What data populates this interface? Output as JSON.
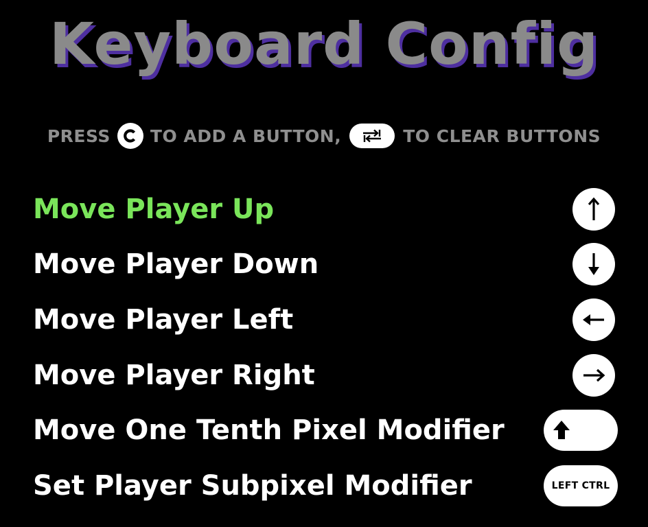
{
  "title": "Keyboard Config",
  "hint": {
    "press": "PRESS",
    "add_key_icon": "c-key-icon",
    "to_add": "TO ADD A BUTTON,",
    "clear_key_icon": "swap-arrows-icon",
    "to_clear": "TO CLEAR BUTTONS"
  },
  "bindings": [
    {
      "label": "Move Player Up",
      "key_icon": "arrow-up-icon",
      "selected": true
    },
    {
      "label": "Move Player Down",
      "key_icon": "arrow-down-icon",
      "selected": false
    },
    {
      "label": "Move Player Left",
      "key_icon": "arrow-left-icon",
      "selected": false
    },
    {
      "label": "Move Player Right",
      "key_icon": "arrow-right-icon",
      "selected": false
    },
    {
      "label": "Move One Tenth Pixel Modifier",
      "key_icon": "shift-key-icon",
      "selected": false
    },
    {
      "label": "Set Player Subpixel Modifier",
      "key_label": "LEFT CTRL",
      "selected": false
    }
  ],
  "colors": {
    "background": "#000000",
    "title": "#8a8a8a",
    "title_shadow": "#4e2fa0",
    "hint": "#8f8f8f",
    "selected": "#7ae55a",
    "label": "#ffffff",
    "key_bg": "#ffffff"
  }
}
